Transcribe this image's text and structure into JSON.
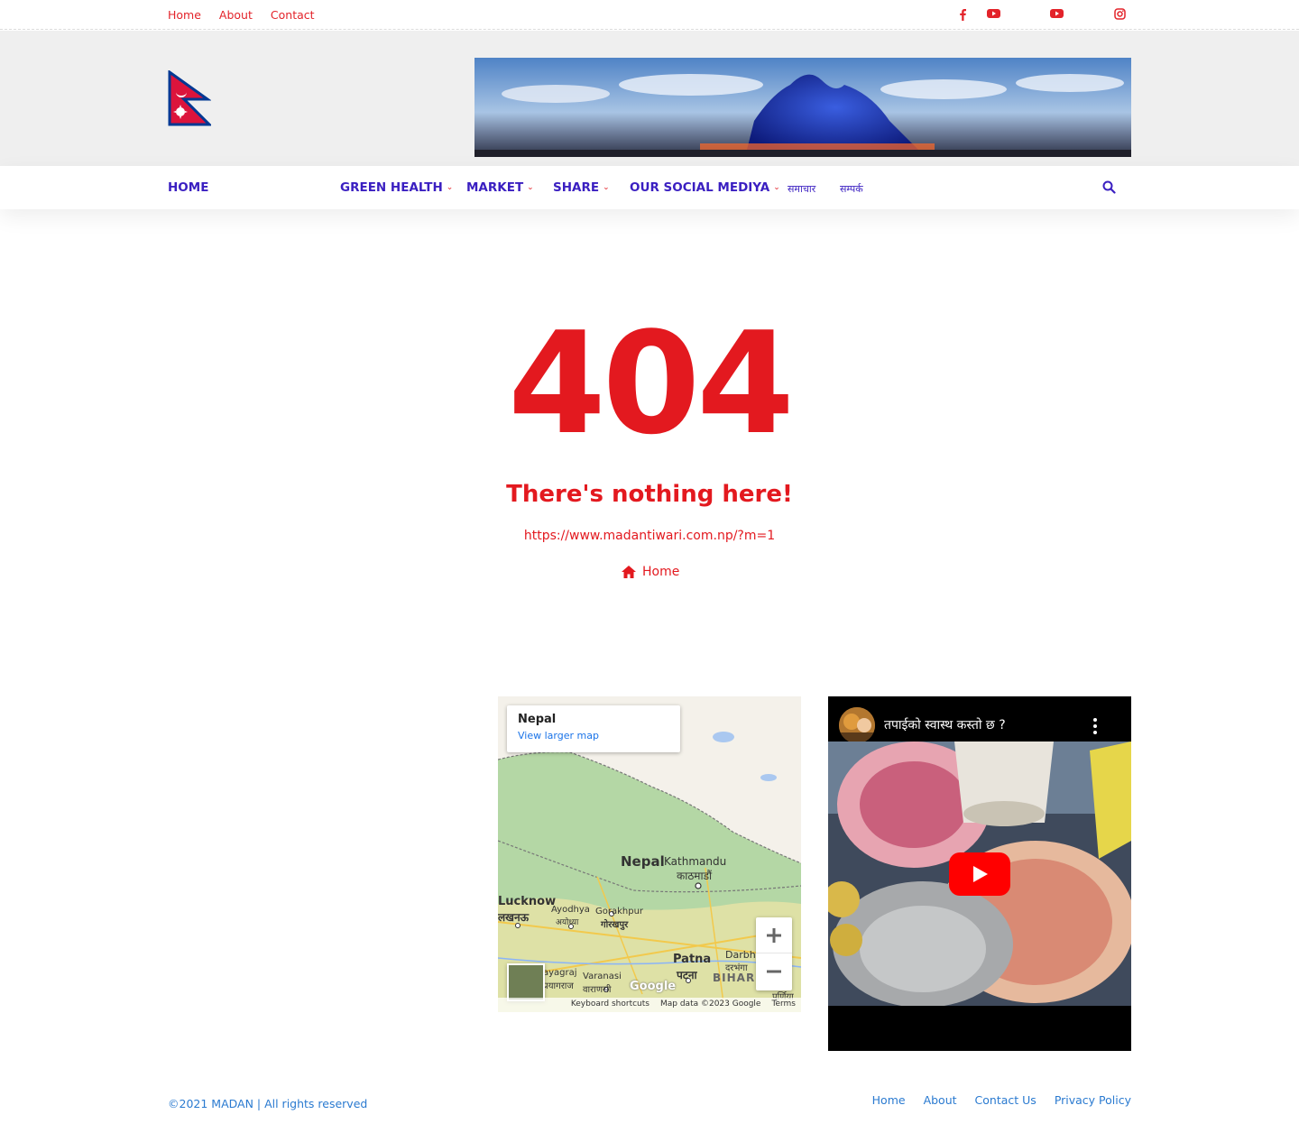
{
  "topbar": {
    "links": [
      "Home",
      "About",
      "Contact"
    ]
  },
  "nav": {
    "home": "HOME",
    "green_health": "GREEN HEALTH",
    "market": "MARKET",
    "share": "SHARE",
    "social": "OUR SOCIAL MEDIYA",
    "extra1": "समाचार",
    "extra2": "सम्पर्क"
  },
  "error": {
    "code": "404",
    "message": "There's nothing here!",
    "url": "https://www.madantiwari.com.np/?m=1",
    "home_label": "Home"
  },
  "map": {
    "card_title": "Nepal",
    "card_link": "View larger map",
    "labels": {
      "nepal": "Nepal",
      "kathmandu": "Kathmandu",
      "kathmandu_dev": "काठमाडौं",
      "lucknow": "Lucknow",
      "lucknow_dev": "लखनऊ",
      "ayodhya": "Ayodhya",
      "ayodhya_dev": "अयोध्या",
      "gorakhpur": "Gorakhpur",
      "gorakhpur_dev": "गोरखपुर",
      "patna": "Patna",
      "patna_dev": "पटना",
      "varanasi": "Varanasi",
      "varanasi_dev": "वाराणसी",
      "prayagraj": "ayagraj",
      "prayagraj_dev": "प्रयागराज",
      "darbhanga": "Darbha",
      "darbhanga_dev": "दरभंगा",
      "bihar": "BIHAR",
      "purnia": "पूर्णिया"
    },
    "attribution": {
      "shortcuts": "Keyboard shortcuts",
      "data": "Map data ©2023 Google",
      "terms": "Terms"
    },
    "logo": "Google"
  },
  "video": {
    "title": "तपाईको स्वास्थ कस्तो छ ?"
  },
  "footer": {
    "copyright": "©2021 MADAN | All rights reserved",
    "links": [
      "Home",
      "About",
      "Contact Us",
      "Privacy Policy"
    ]
  },
  "colors": {
    "accent_red": "#e3191f",
    "nav_blue": "#3a1fc1",
    "footer_blue": "#2a7ad0"
  }
}
